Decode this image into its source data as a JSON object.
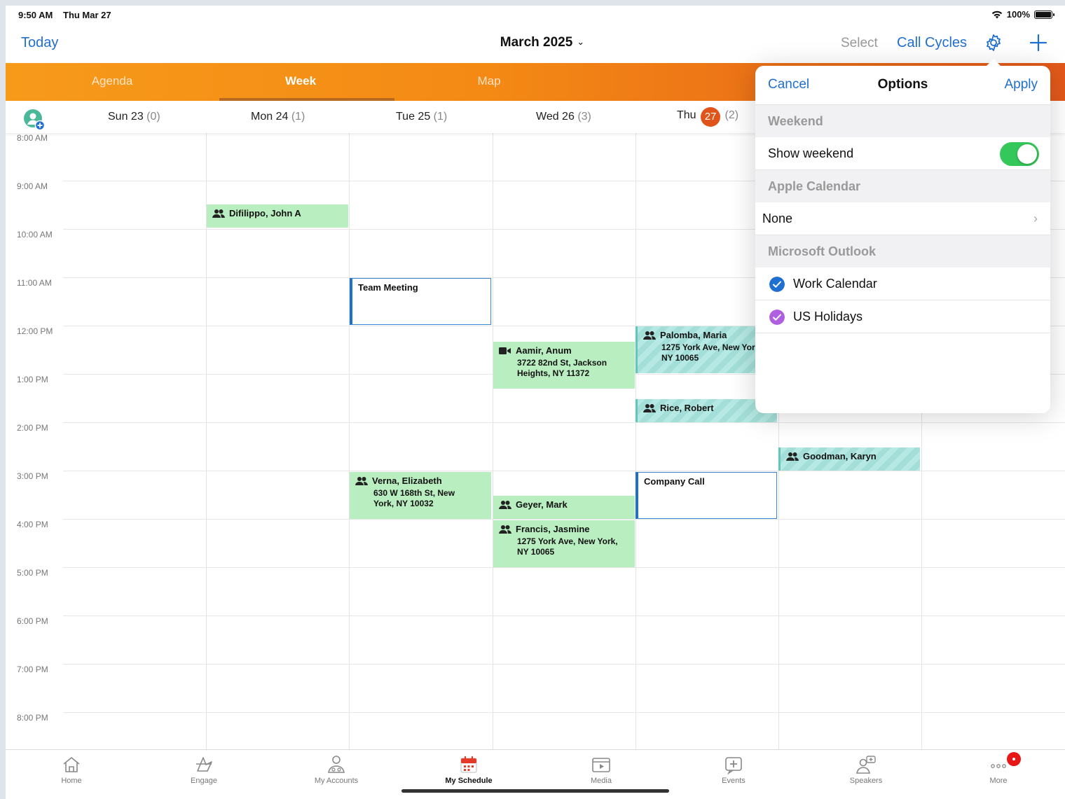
{
  "status": {
    "time": "9:50 AM",
    "date": "Thu Mar 27",
    "battery": "100%"
  },
  "nav": {
    "today": "Today",
    "title": "March 2025",
    "select": "Select",
    "call_cycles": "Call Cycles"
  },
  "segments": [
    "Agenda",
    "Week",
    "Map"
  ],
  "days": [
    {
      "label": "Sun 23",
      "count": "(0)"
    },
    {
      "label": "Mon 24",
      "count": "(1)"
    },
    {
      "label": "Tue 25",
      "count": "(1)"
    },
    {
      "label": "Wed 26",
      "count": "(3)"
    },
    {
      "label_pre": "Thu",
      "badge": "27",
      "count": "(2)"
    }
  ],
  "times": [
    "8:00 AM",
    "9:00 AM",
    "10:00 AM",
    "11:00 AM",
    "12:00 PM",
    "1:00 PM",
    "2:00 PM",
    "3:00 PM",
    "4:00 PM",
    "5:00 PM",
    "6:00 PM",
    "7:00 PM",
    "8:00 PM"
  ],
  "events": {
    "difilippo": {
      "title": "Difilippo, John A"
    },
    "team_meeting": {
      "title": "Team Meeting"
    },
    "palomba": {
      "title": "Palomba, Maria",
      "addr1": "1275 York Ave, New York,",
      "addr2": "NY 10065"
    },
    "aamir": {
      "title": "Aamir, Anum",
      "addr1": "3722 82nd St, Jackson",
      "addr2": "Heights, NY 11372"
    },
    "rice": {
      "title": "Rice, Robert"
    },
    "goodman": {
      "title": "Goodman, Karyn"
    },
    "verna": {
      "title": "Verna, Elizabeth",
      "addr1": "630 W 168th St, New",
      "addr2": "York, NY 10032"
    },
    "geyer": {
      "title": "Geyer, Mark"
    },
    "company_call": {
      "title": "Company Call"
    },
    "francis": {
      "title": "Francis, Jasmine",
      "addr1": "1275 York Ave, New York,",
      "addr2": "NY 10065"
    }
  },
  "options": {
    "cancel": "Cancel",
    "title": "Options",
    "apply": "Apply",
    "weekend_header": "Weekend",
    "show_weekend": "Show weekend",
    "show_weekend_on": true,
    "apple_header": "Apple Calendar",
    "apple_value": "None",
    "outlook_header": "Microsoft Outlook",
    "work_calendar": "Work Calendar",
    "us_holidays": "US Holidays",
    "work_color": "#1f6fd1",
    "holiday_color": "#b05fe0"
  },
  "tabs": [
    "Home",
    "Engage",
    "My Accounts",
    "My Schedule",
    "Media",
    "Events",
    "Speakers",
    "More"
  ],
  "colors": {
    "accent": "#1f6fd1",
    "brand_orange": "#f48a14",
    "today_badge": "#e0541a",
    "visit_green": "#b9eec0",
    "visit_teal": "#a3dfd8"
  }
}
